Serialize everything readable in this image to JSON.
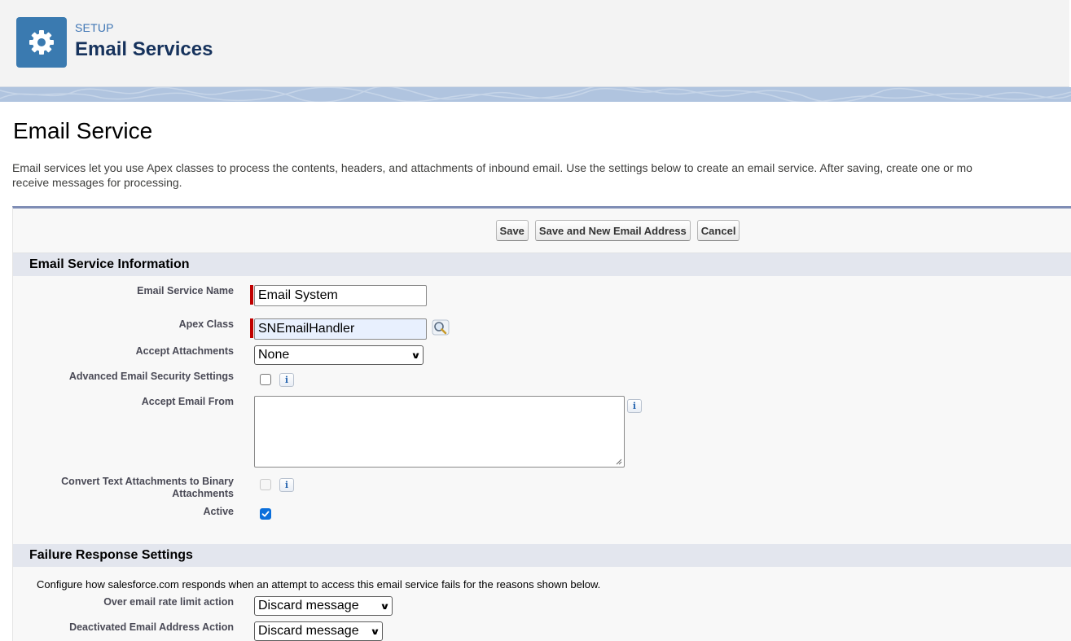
{
  "header": {
    "kicker": "SETUP",
    "title": "Email Services",
    "icon": "gear-icon",
    "icon_bg": "#3a7ab0"
  },
  "page": {
    "heading": "Email Service",
    "description_line1": "Email services let you use Apex classes to process the contents, headers, and attachments of inbound email. Use the settings below to create an email service. After saving, create one or mo",
    "description_line2": "receive messages for processing."
  },
  "buttons": {
    "save": "Save",
    "save_new": "Save and New Email Address",
    "cancel": "Cancel"
  },
  "sections": {
    "info": "Email Service Information",
    "failure": "Failure Response Settings"
  },
  "fields": {
    "service_name": {
      "label": "Email Service Name",
      "value": "Email System",
      "required": true
    },
    "apex_class": {
      "label": "Apex Class",
      "value": "SNEmailHandler",
      "required": true,
      "lookup_icon": "lookup-magnifier-icon"
    },
    "accept_attachments": {
      "label": "Accept Attachments",
      "value": "None"
    },
    "advanced_security": {
      "label": "Advanced Email Security Settings",
      "checked": false
    },
    "accept_email_from": {
      "label": "Accept Email From",
      "value": ""
    },
    "convert_text": {
      "label_line1": "Convert Text Attachments to Binary",
      "label_line2": "Attachments",
      "checked": false,
      "disabled": true
    },
    "active": {
      "label": "Active",
      "checked": true
    }
  },
  "failure": {
    "description": "Configure how salesforce.com responds when an attempt to access this email service fails for the reasons shown below.",
    "rate_limit": {
      "label": "Over email rate limit action",
      "value": "Discard message"
    },
    "deactivated_address": {
      "label": "Deactivated Email Address Action",
      "value": "Discard message"
    }
  },
  "colors": {
    "accent_blue": "#3a7ab0",
    "required_red": "#c00000",
    "section_bg": "#e3e6ee",
    "checkbox_checked": "#0b6fdb"
  }
}
